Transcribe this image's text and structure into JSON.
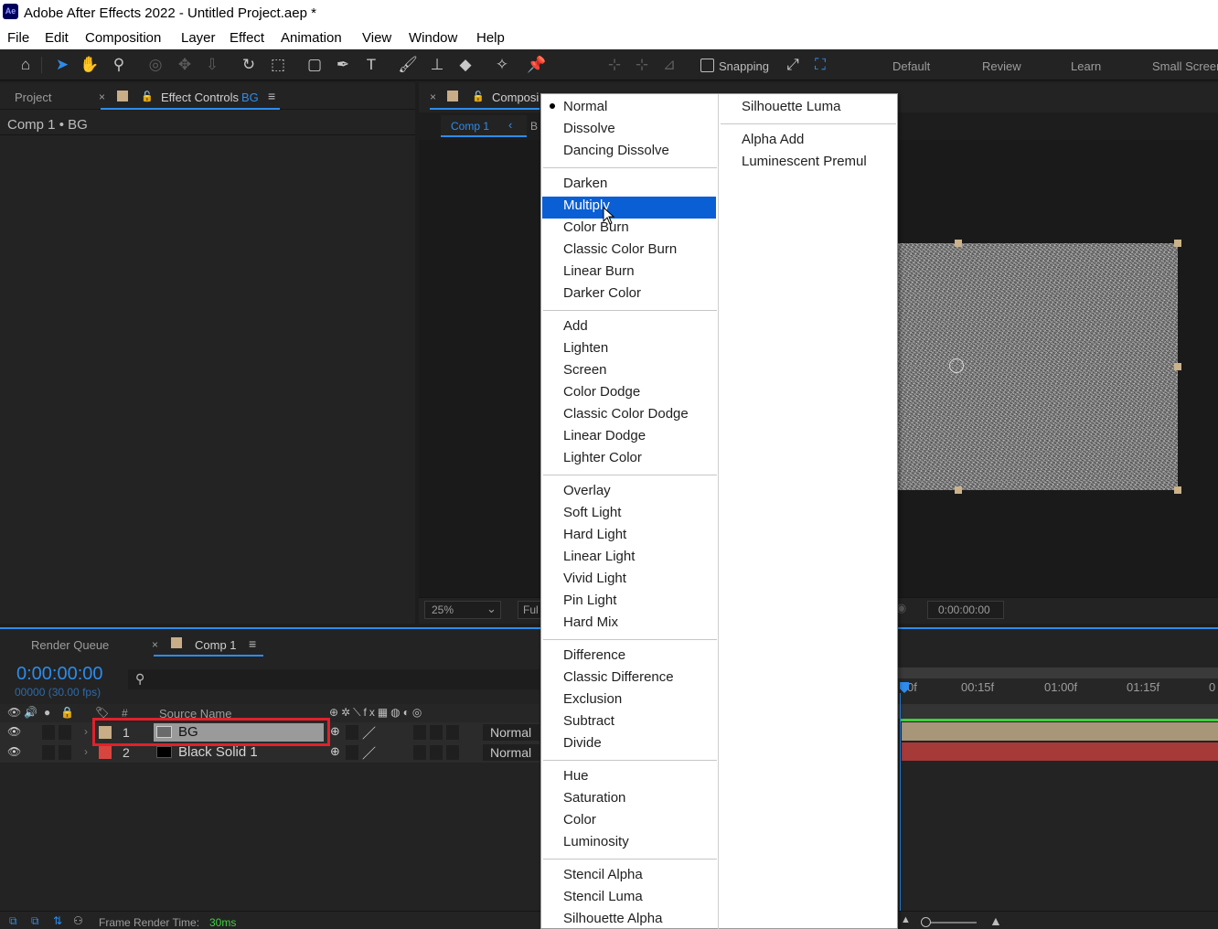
{
  "window": {
    "app_icon": "Ae",
    "title": "Adobe After Effects 2022 - Untitled Project.aep *"
  },
  "menu": [
    "File",
    "Edit",
    "Composition",
    "Layer",
    "Effect",
    "Animation",
    "View",
    "Window",
    "Help"
  ],
  "toolbar": {
    "snapping_label": "Snapping",
    "workspaces": [
      "Default",
      "Review",
      "Learn",
      "Small Screen"
    ]
  },
  "project_panel": {
    "tab_project": "Project",
    "tab_effect_controls": "Effect Controls",
    "effect_controls_target": "BG",
    "breadcrumb": "Comp 1 • BG"
  },
  "comp_panel": {
    "tab_label": "Composi",
    "subtab": "Comp 1",
    "subtab_next": "B",
    "zoom": "25%",
    "resolution": "Ful",
    "timecode": "0:00:00:00"
  },
  "timeline": {
    "tab_render_queue": "Render Queue",
    "tab_comp": "Comp 1",
    "timecode": "0:00:00:00",
    "frame_info": "00000 (30.00 fps)",
    "header_hash": "#",
    "header_source": "Source Name",
    "ruler": [
      "0f",
      "00:15f",
      "01:00f",
      "01:15f",
      "0"
    ],
    "layers": [
      {
        "num": "1",
        "name": "BG",
        "mode": "Normal",
        "label_color": "#c8ad87",
        "thumb_color": "#6a6a6a"
      },
      {
        "num": "2",
        "name": "Black Solid 1",
        "mode": "Normal",
        "label_color": "#d8453f",
        "thumb_color": "#000000"
      }
    ],
    "status_label": "Frame Render Time:",
    "status_value": "30ms"
  },
  "blend_menu": {
    "selected": "Multiply",
    "checked": "Normal",
    "col1": [
      "Normal",
      "Dissolve",
      "Dancing Dissolve",
      "Darken",
      "Multiply",
      "Color Burn",
      "Classic Color Burn",
      "Linear Burn",
      "Darker Color",
      "Add",
      "Lighten",
      "Screen",
      "Color Dodge",
      "Classic Color Dodge",
      "Linear Dodge",
      "Lighter Color",
      "Overlay",
      "Soft Light",
      "Hard Light",
      "Linear Light",
      "Vivid Light",
      "Pin Light",
      "Hard Mix",
      "Difference",
      "Classic Difference",
      "Exclusion",
      "Subtract",
      "Divide",
      "Hue",
      "Saturation",
      "Color",
      "Luminosity",
      "Stencil Alpha",
      "Stencil Luma",
      "Silhouette Alpha"
    ],
    "col2": [
      "Silhouette Luma",
      "Alpha Add",
      "Luminescent Premul"
    ]
  },
  "colors": {
    "accent": "#2d8ceb",
    "menu_highlight": "#0a5fd4",
    "highlight_box": "#e0212b"
  }
}
